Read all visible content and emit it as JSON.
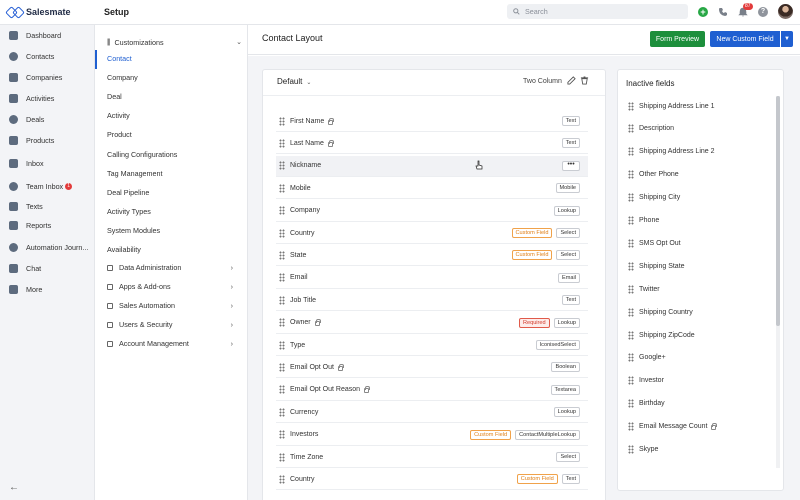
{
  "app": {
    "brand": "Salesmate",
    "section_title": "Setup"
  },
  "search": {
    "placeholder": "Search"
  },
  "topbar": {
    "notification_count": "87",
    "help": "?"
  },
  "left_nav": {
    "items": [
      {
        "label": "Dashboard",
        "icon": "dashboard-icon"
      },
      {
        "label": "Contacts",
        "icon": "contacts-icon"
      },
      {
        "label": "Companies",
        "icon": "companies-icon"
      },
      {
        "label": "Activities",
        "icon": "activities-icon"
      },
      {
        "label": "Deals",
        "icon": "deals-icon"
      },
      {
        "label": "Products",
        "icon": "products-icon"
      },
      {
        "label": "Inbox",
        "icon": "inbox-icon"
      },
      {
        "label": "Team Inbox",
        "icon": "team-inbox-icon",
        "badge": "1"
      },
      {
        "label": "Texts",
        "icon": "texts-icon"
      },
      {
        "label": "Reports",
        "icon": "reports-icon"
      },
      {
        "label": "Automation Journ...",
        "icon": "automation-icon"
      },
      {
        "label": "Chat",
        "icon": "chat-icon"
      },
      {
        "label": "More",
        "icon": "more-icon"
      }
    ],
    "collapse": "←"
  },
  "settings_nav": {
    "group_title": "Customizations",
    "items": [
      "Contact",
      "Company",
      "Deal",
      "Activity",
      "Product",
      "Calling Configurations",
      "Tag Management",
      "Deal Pipeline",
      "Activity Types",
      "System Modules",
      "Availability"
    ],
    "groups": [
      "Data Administration",
      "Apps & Add-ons",
      "Sales Automation",
      "Users & Security",
      "Account Management"
    ]
  },
  "page": {
    "title": "Contact Layout",
    "form_preview": "Form Preview",
    "new_custom_field": "New Custom Field"
  },
  "layout": {
    "name": "Default",
    "mode": "Two Column",
    "fields": [
      {
        "label": "First Name",
        "locked": true,
        "tags": [
          {
            "text": "Text",
            "kind": "type"
          }
        ]
      },
      {
        "label": "Last Name",
        "locked": true,
        "tags": [
          {
            "text": "Text",
            "kind": "type"
          }
        ]
      },
      {
        "label": "Nickname",
        "locked": false,
        "more": "•••",
        "tags": []
      },
      {
        "label": "Mobile",
        "locked": false,
        "tags": [
          {
            "text": "Mobile",
            "kind": "type"
          }
        ]
      },
      {
        "label": "Company",
        "locked": false,
        "tags": [
          {
            "text": "Lookup",
            "kind": "type"
          }
        ]
      },
      {
        "label": "Country",
        "locked": false,
        "tags": [
          {
            "text": "Custom Field",
            "kind": "custom"
          },
          {
            "text": "Select",
            "kind": "type"
          }
        ]
      },
      {
        "label": "State",
        "locked": false,
        "tags": [
          {
            "text": "Custom Field",
            "kind": "custom"
          },
          {
            "text": "Select",
            "kind": "type"
          }
        ]
      },
      {
        "label": "Email",
        "locked": false,
        "tags": [
          {
            "text": "Email",
            "kind": "type"
          }
        ]
      },
      {
        "label": "Job Title",
        "locked": false,
        "tags": [
          {
            "text": "Text",
            "kind": "type"
          }
        ]
      },
      {
        "label": "Owner",
        "locked": true,
        "tags": [
          {
            "text": "Required",
            "kind": "req"
          },
          {
            "text": "Lookup",
            "kind": "type"
          }
        ]
      },
      {
        "label": "Type",
        "locked": false,
        "tags": [
          {
            "text": "IconisedSelect",
            "kind": "type"
          }
        ]
      },
      {
        "label": "Email Opt Out",
        "locked": true,
        "tags": [
          {
            "text": "Boolean",
            "kind": "type"
          }
        ]
      },
      {
        "label": "Email Opt Out Reason",
        "locked": true,
        "tags": [
          {
            "text": "Textarea",
            "kind": "type"
          }
        ]
      },
      {
        "label": "Currency",
        "locked": false,
        "tags": [
          {
            "text": "Lookup",
            "kind": "type"
          }
        ]
      },
      {
        "label": "Investors",
        "locked": false,
        "tags": [
          {
            "text": "Custom Field",
            "kind": "custom"
          },
          {
            "text": "ContactMultipleLookup",
            "kind": "type"
          }
        ]
      },
      {
        "label": "Time Zone",
        "locked": false,
        "tags": [
          {
            "text": "Select",
            "kind": "type"
          }
        ]
      },
      {
        "label": "Country",
        "locked": false,
        "tags": [
          {
            "text": "Custom Field",
            "kind": "custom"
          },
          {
            "text": "Text",
            "kind": "type"
          }
        ]
      }
    ]
  },
  "inactive": {
    "title": "Inactive fields",
    "fields": [
      {
        "label": "Shipping Address Line 1",
        "locked": false
      },
      {
        "label": "Description",
        "locked": false
      },
      {
        "label": "Shipping Address Line 2",
        "locked": false
      },
      {
        "label": "Other Phone",
        "locked": false
      },
      {
        "label": "Shipping City",
        "locked": false
      },
      {
        "label": "Phone",
        "locked": false
      },
      {
        "label": "SMS Opt Out",
        "locked": false
      },
      {
        "label": "Shipping State",
        "locked": false
      },
      {
        "label": "Twitter",
        "locked": false
      },
      {
        "label": "Shipping Country",
        "locked": false
      },
      {
        "label": "Shipping ZipCode",
        "locked": false
      },
      {
        "label": "Google+",
        "locked": false
      },
      {
        "label": "Investor",
        "locked": false
      },
      {
        "label": "Birthday",
        "locked": false
      },
      {
        "label": "Email Message Count",
        "locked": true
      },
      {
        "label": "Skype",
        "locked": false
      }
    ]
  }
}
